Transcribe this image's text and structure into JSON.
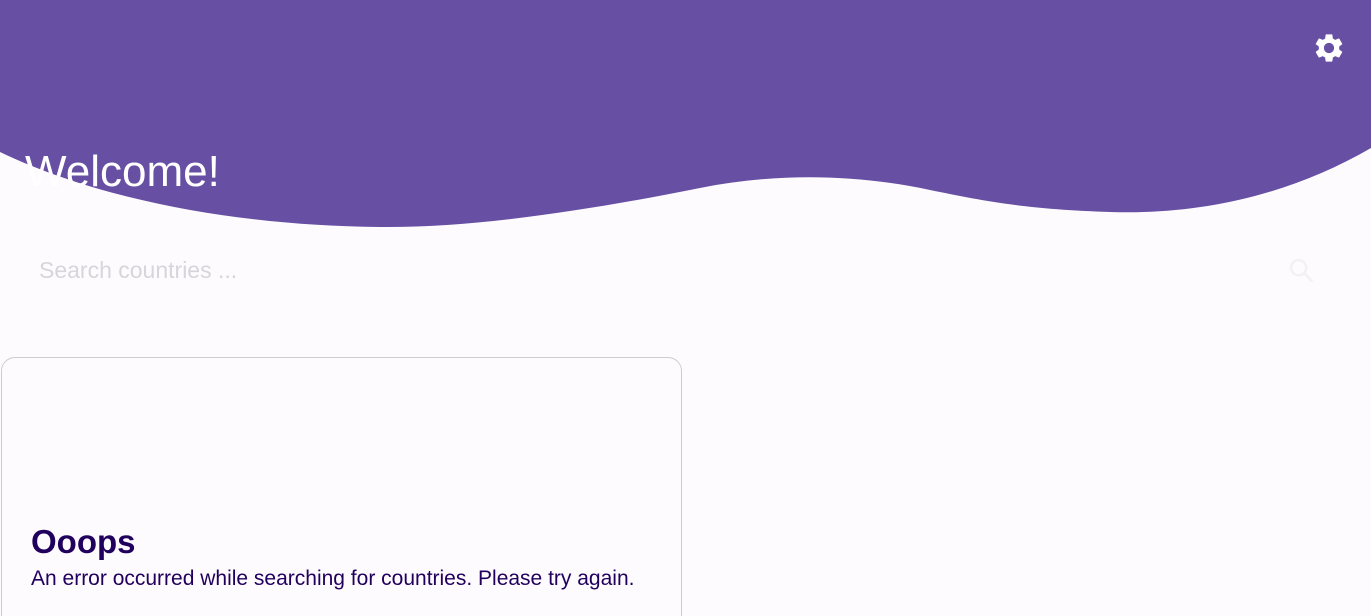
{
  "colors": {
    "header_bg": "#6750a4",
    "page_bg": "#fefbfe",
    "error_text": "#21005d",
    "placeholder": "#d7d4dc",
    "card_border": "#cfcbd1"
  },
  "header": {
    "welcome_text": "Welcome!",
    "settings_icon": "gear-icon"
  },
  "search": {
    "placeholder": "Search countries ...",
    "value": "",
    "icon": "search-icon"
  },
  "error_card": {
    "title": "Ooops",
    "message": "An error occurred while searching for countries. Please try again."
  }
}
